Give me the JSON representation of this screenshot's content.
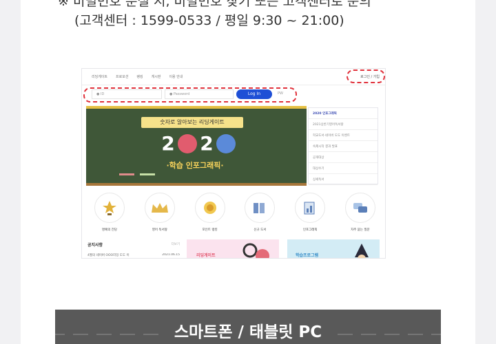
{
  "notice": {
    "mark": "※",
    "line1": "비밀번호 분실 시, 비밀번호 찾기 또는 고객센터로 문의",
    "line2": "(고객센터 : 1599-0533 / 평일 9:30 ~ 21:00)"
  },
  "site": {
    "nav": [
      "리딩게이트",
      "프로모션",
      "랭킹",
      "게시판",
      "이용 안내"
    ],
    "login_link": "로그인 / 가입",
    "id_placeholder": "ID",
    "pw_placeholder": "Password",
    "login_button": "Log In",
    "pw_find": "PW",
    "banner": {
      "title": "숫자로 알아보는 리딩게이트",
      "year": "2020",
      "subtitle": "·학습 인포그래픽·"
    },
    "side_list": [
      "2020 인포그래픽",
      "2021상반기영어독서왕",
      "학교도서·네이버 도도 이벤트",
      "숙제시작 결과 발표",
      "공개대상",
      "대상수기",
      "상세독서"
    ],
    "icons": [
      {
        "label": "명예의 전당",
        "icon": "trophy-icon"
      },
      {
        "label": "영어 독서왕",
        "icon": "crown-icon"
      },
      {
        "label": "포인트 랭킹",
        "icon": "medal-icon"
      },
      {
        "label": "신규 도서",
        "icon": "books-icon"
      },
      {
        "label": "인포그래픽",
        "icon": "infographic-icon"
      },
      {
        "label": "자주 묻는 질문",
        "icon": "faq-chat-icon"
      }
    ],
    "notice_board": {
      "title": "공지사항",
      "more": "더보기",
      "item": "4월의 네이버 OOO리딩 도도 이",
      "date": "2021.06.15"
    },
    "promo1": "리딩게이트",
    "promo2": "학습프로그램"
  },
  "section": {
    "title": "스마트폰 / 태블릿 PC"
  },
  "colors": {
    "highlight": "#e0303a",
    "login_button": "#1e4fd6",
    "section_bar": "#595959"
  }
}
